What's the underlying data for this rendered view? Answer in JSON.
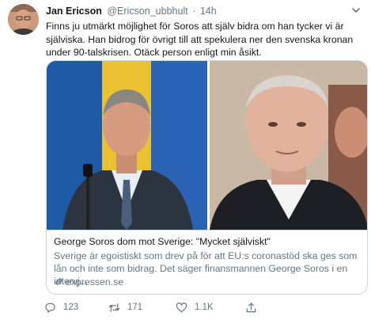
{
  "tweet": {
    "author_name": "Jan Ericson",
    "author_handle": "@Ericson_ubbhult",
    "separator": "·",
    "time": "14h",
    "text": "Finns ju utmärkt möjlighet för Soros att själv bidra om han tycker vi är själviska. Han bidrog för övrigt till att spekulera ner den svenska kronan under 90-talskrisen. Otäck person enligt min åsikt."
  },
  "card": {
    "title": "George Soros dom mot Sverige: \"Mycket själviskt\"",
    "description": "Sverige är egoistiskt som drev på för att EU:s coronastöd ska ges som lån och inte som bidrag. Det säger finansmannen George Soros i en intervj...",
    "domain": "expressen.se"
  },
  "actions": {
    "reply_count": "123",
    "retweet_count": "171",
    "like_count": "1.1K"
  },
  "icons": {
    "more": "chevron-down-icon",
    "reply": "reply-icon",
    "retweet": "retweet-icon",
    "like": "heart-icon",
    "share": "share-icon",
    "link": "link-icon"
  },
  "colors": {
    "text_primary": "#14171a",
    "text_secondary": "#657786",
    "border": "#ccd6dd"
  }
}
